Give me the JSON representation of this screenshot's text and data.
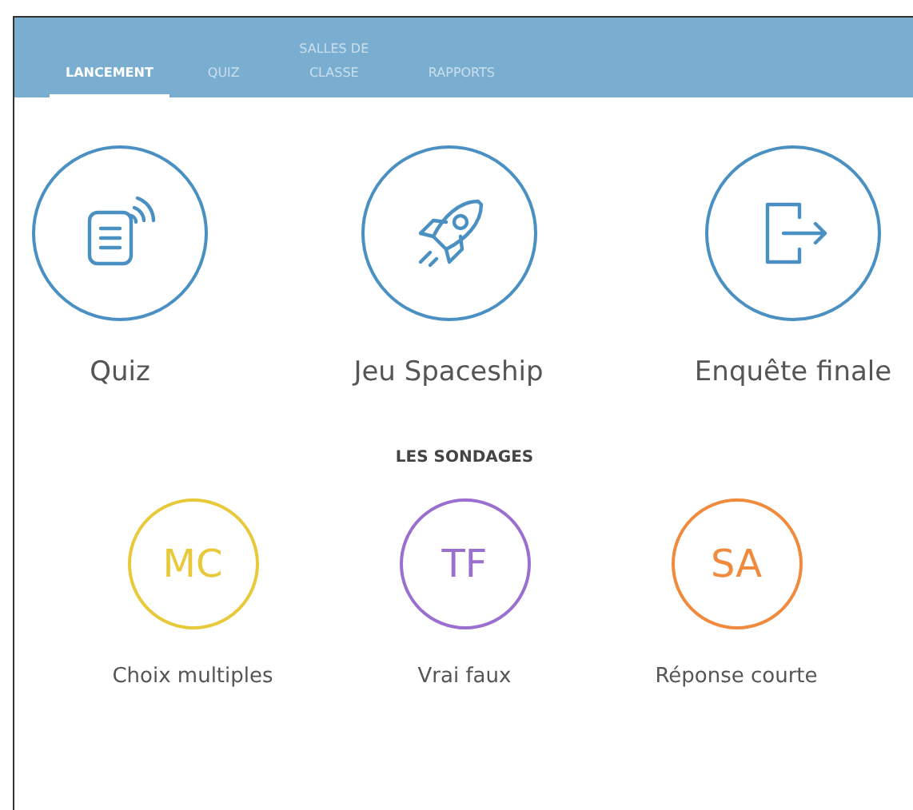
{
  "tabs": [
    {
      "label": "LANCEMENT",
      "selected": true
    },
    {
      "label": "QUIZ",
      "selected": false
    },
    {
      "label": "SALLES DE CLASSE",
      "selected": false
    },
    {
      "label": "RAPPORTS",
      "selected": false
    }
  ],
  "launch_items": [
    {
      "kind": "quiz",
      "label": "Quiz"
    },
    {
      "kind": "rocket",
      "label": "Jeu Spaceship"
    },
    {
      "kind": "exit",
      "label": "Enquête finale"
    }
  ],
  "polls": {
    "title": "LES SONDAGES",
    "items": [
      {
        "abbr": "MC",
        "label": "Choix multiples",
        "color": "#e8c93a"
      },
      {
        "abbr": "TF",
        "label": "Vrai faux",
        "color": "#9b6fd0"
      },
      {
        "abbr": "SA",
        "label": "Réponse courte",
        "color": "#f08a3c"
      }
    ]
  }
}
